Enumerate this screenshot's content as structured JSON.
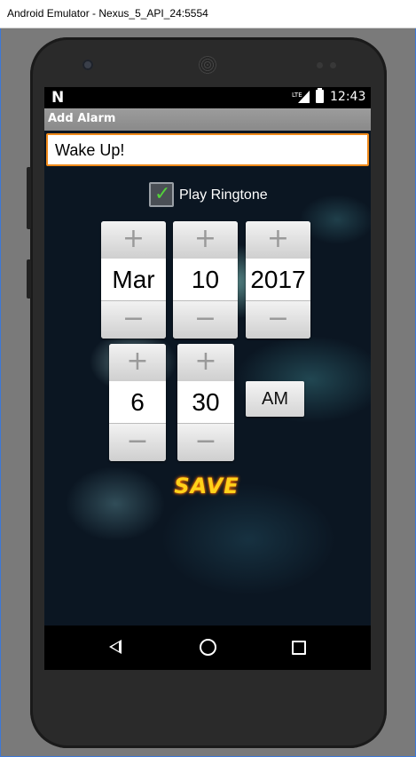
{
  "window": {
    "title": "Android Emulator - Nexus_5_API_24:5554"
  },
  "statusbar": {
    "network_label": "LTE",
    "time": "12:43"
  },
  "actionbar": {
    "title": "Add Alarm"
  },
  "alarm": {
    "name_value": "Wake Up!",
    "play_ringtone_label": "Play Ringtone",
    "play_ringtone_checked": true,
    "date": {
      "month": "Mar",
      "day": "10",
      "year": "2017"
    },
    "time": {
      "hour": "6",
      "minute": "30",
      "ampm": "AM"
    },
    "save_label": "SAVE"
  },
  "picker": {
    "increment_symbol": "+",
    "decrement_symbol": "−"
  },
  "icons": {
    "check": "✓",
    "notification": "N"
  },
  "colors": {
    "accent_orange": "#f08a1a",
    "check_green": "#53d33a",
    "save_yellow": "#ffd21a"
  }
}
